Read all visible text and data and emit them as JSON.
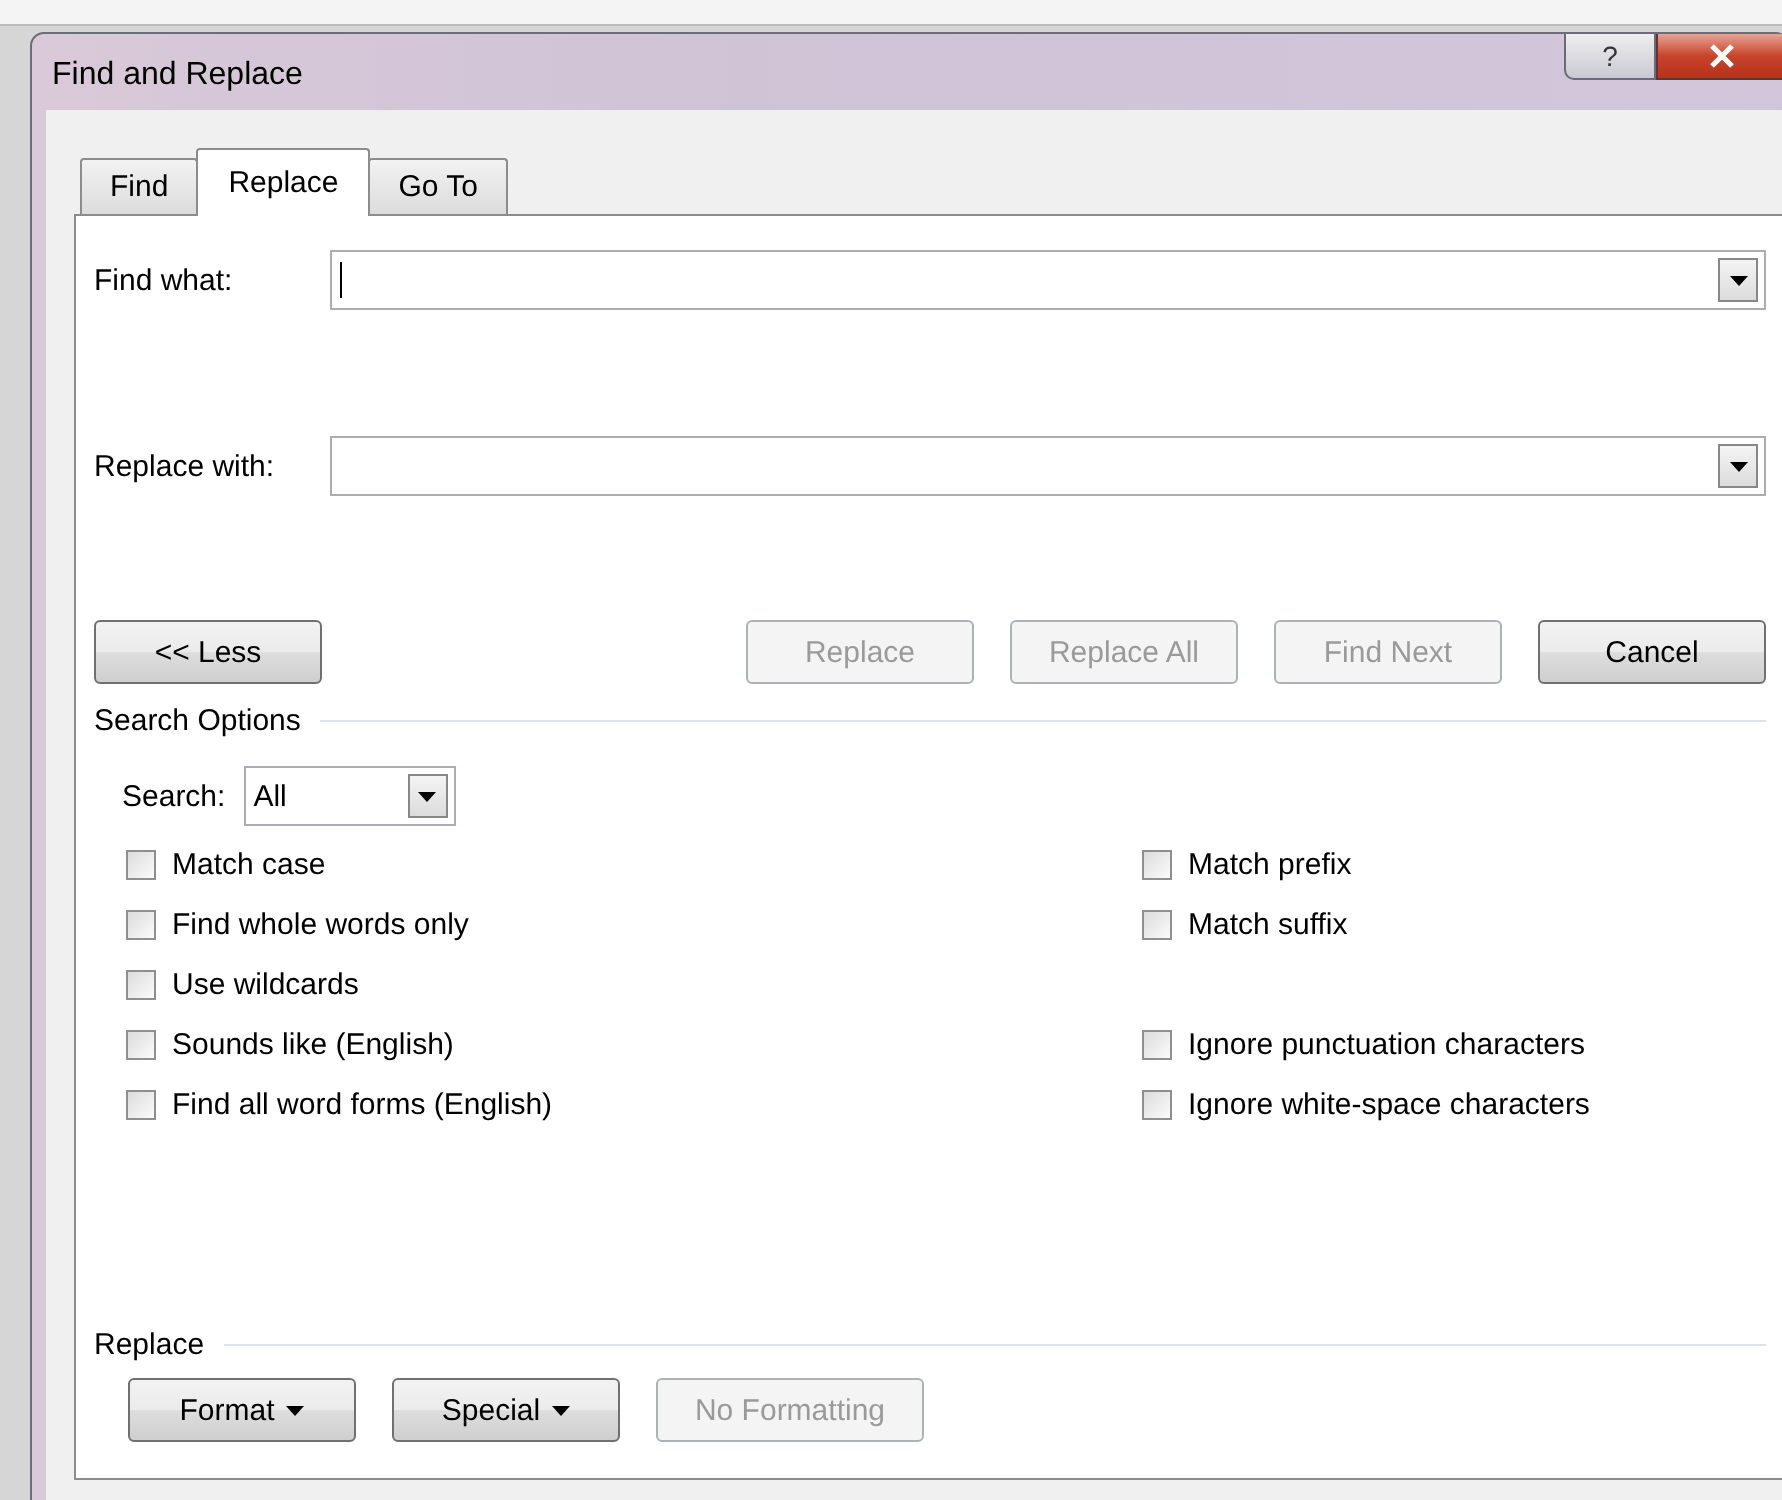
{
  "window": {
    "title": "Find and Replace",
    "help_label": "?"
  },
  "tabs": [
    {
      "label": "Find",
      "selected": false
    },
    {
      "label": "Replace",
      "selected": true
    },
    {
      "label": "Go To",
      "selected": false
    }
  ],
  "find_what": {
    "label": "Find what:",
    "focused": true
  },
  "replace_with": {
    "label": "Replace with:",
    "focused": false
  },
  "buttons": [
    {
      "label": "<< Less",
      "disabled": false
    },
    {
      "label": "Replace",
      "disabled": true
    },
    {
      "label": "Replace All",
      "disabled": true
    },
    {
      "label": "Find Next",
      "disabled": true
    },
    {
      "label": "Cancel",
      "disabled": false
    }
  ],
  "search_options": {
    "title": "Search Options",
    "search_label": "Search:",
    "search_value": "All",
    "left": [
      {
        "label": "Match case",
        "checked": false
      },
      {
        "label": "Find whole words only",
        "checked": false
      },
      {
        "label": "Use wildcards",
        "checked": false
      },
      {
        "label": "Sounds like (English)",
        "checked": false
      },
      {
        "label": "Find all word forms (English)",
        "checked": false
      }
    ],
    "right_groups": [
      [
        {
          "label": "Match prefix",
          "checked": false
        },
        {
          "label": "Match suffix",
          "checked": false
        }
      ],
      [
        {
          "label": "Ignore punctuation characters",
          "checked": false
        },
        {
          "label": "Ignore white-space characters",
          "checked": false
        }
      ]
    ]
  },
  "replace_section": {
    "title": "Replace",
    "buttons": [
      {
        "label": "Format",
        "dropdown": true,
        "disabled": false
      },
      {
        "label": "Special",
        "dropdown": true,
        "disabled": false
      },
      {
        "label": "No Formatting",
        "dropdown": false,
        "disabled": true
      }
    ]
  }
}
